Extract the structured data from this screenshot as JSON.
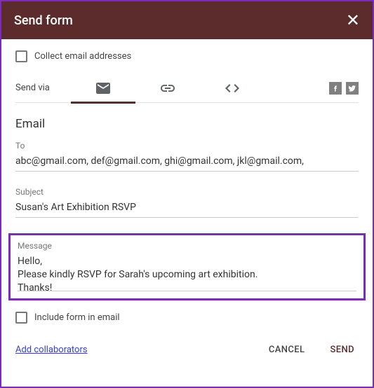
{
  "header": {
    "title": "Send form"
  },
  "collect_email_label": "Collect email addresses",
  "send_via_label": "Send via",
  "section_title": "Email",
  "to": {
    "label": "To",
    "value": "abc@gmail.com, def@gmail.com, ghi@gmail.com, jkl@gmail.com,"
  },
  "subject": {
    "label": "Subject",
    "value": "Susan's Art Exhibition RSVP"
  },
  "message": {
    "label": "Message",
    "value": "Hello,\nPlease kindly RSVP for Sarah's upcoming art exhibition.\nThanks!"
  },
  "include_form_label": "Include form in email",
  "add_collaborators": "Add collaborators",
  "actions": {
    "cancel": "CANCEL",
    "send": "SEND"
  }
}
